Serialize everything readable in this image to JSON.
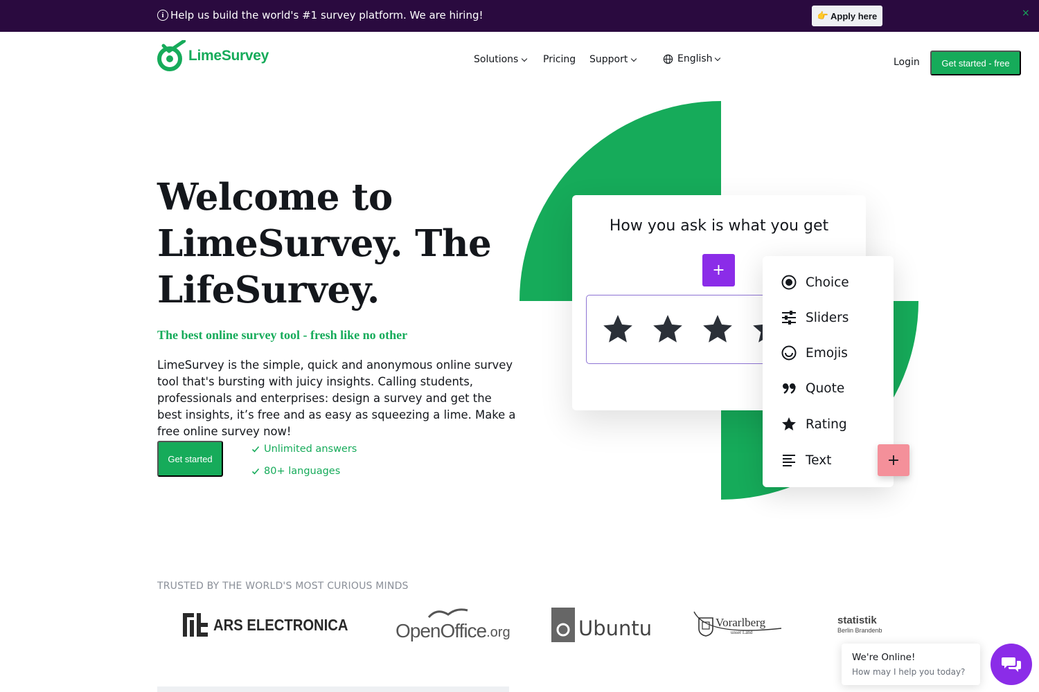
{
  "banner": {
    "message": "Help us build the world's #1 survey platform. We are hiring!",
    "apply_emoji": "👉",
    "apply_label": "Apply here",
    "close": "×"
  },
  "header": {
    "logo_text": "LimeSurvey",
    "nav": [
      {
        "label": "Solutions"
      },
      {
        "label": "Pricing"
      },
      {
        "label": "Support"
      }
    ],
    "language": "English",
    "login": "Login",
    "cta": "Get started - free"
  },
  "hero": {
    "title": "Welcome to LimeSurvey. The LifeSurvey.",
    "subtitle": "The best online survey tool - fresh like no other",
    "description": "LimeSurvey is the simple, quick and anonymous online survey tool that's bursting with juicy insights. Calling students, professionals and enterprises: design a survey and get the best insights, it’s free and as easy as squeezing a lime. Make a free online survey now!",
    "cta": "Get started",
    "checks": [
      "Unlimited answers",
      "80+ languages"
    ]
  },
  "illustration": {
    "card_title": "How you ask is what you get",
    "plus": "+",
    "menu": [
      {
        "label": "Choice",
        "icon": "radio-icon"
      },
      {
        "label": "Sliders",
        "icon": "sliders-icon"
      },
      {
        "label": "Emojis",
        "icon": "emoji-icon"
      },
      {
        "label": "Quote",
        "icon": "quote-icon"
      },
      {
        "label": "Rating",
        "icon": "star-icon"
      },
      {
        "label": "Text",
        "icon": "text-lines-icon"
      }
    ]
  },
  "trusted": {
    "heading": "TRUSTED BY THE WORLD'S MOST CURIOUS MINDS",
    "logos": [
      "ARS ELECTRONICA",
      "OpenOffice",
      ".org",
      "Ubuntu",
      "Vorarlberg",
      "unser Land",
      "statistik",
      "Berlin Brandenb"
    ]
  },
  "chat": {
    "title": "We're Online!",
    "subtitle": "How may I help you today?"
  },
  "colors": {
    "brand_green": "#16ab5a",
    "banner_bg": "#2a0a3f",
    "purple": "#8b2ce8",
    "pink": "#f4909a"
  }
}
